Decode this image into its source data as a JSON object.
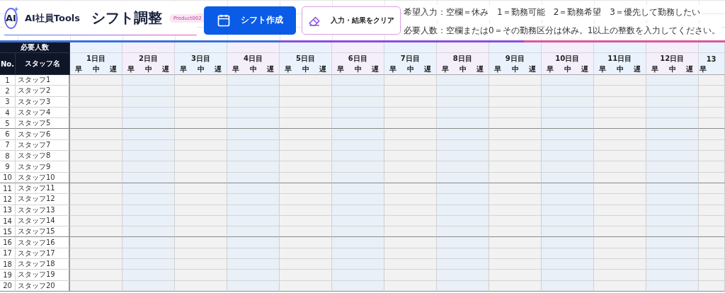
{
  "logo": {
    "mark": "AI",
    "name": "AI社員Tools"
  },
  "title": "シフト調整",
  "badge": "Product002",
  "buttons": [
    {
      "kind": "primary",
      "label": "シフト作成"
    },
    {
      "kind": "outline",
      "label": "入力・結果をクリア"
    }
  ],
  "notes": [
    "希望入力：空欄＝休み　1＝勤務可能　2＝勤務希望　3＝優先して勤務したい",
    "必要人数：空欄または0＝その勤務区分は休み。1以上の整数を入力してください。"
  ],
  "table": {
    "required_label": "必要人数",
    "no_header": "No.",
    "name_header": "スタッフ名",
    "days": [
      {
        "label": "1日目",
        "shifts": [
          "早",
          "中",
          "遅"
        ]
      },
      {
        "label": "2日目",
        "shifts": [
          "早",
          "中",
          "遅"
        ]
      },
      {
        "label": "3日目",
        "shifts": [
          "早",
          "中",
          "遅"
        ]
      },
      {
        "label": "4日目",
        "shifts": [
          "早",
          "中",
          "遅"
        ]
      },
      {
        "label": "5日目",
        "shifts": [
          "早",
          "中",
          "遅"
        ]
      },
      {
        "label": "6日目",
        "shifts": [
          "早",
          "中",
          "遅"
        ]
      },
      {
        "label": "7日目",
        "shifts": [
          "早",
          "中",
          "遅"
        ]
      },
      {
        "label": "8日目",
        "shifts": [
          "早",
          "中",
          "遅"
        ]
      },
      {
        "label": "9日目",
        "shifts": [
          "早",
          "中",
          "遅"
        ]
      },
      {
        "label": "10日目",
        "shifts": [
          "早",
          "中",
          "遅"
        ]
      },
      {
        "label": "11日目",
        "shifts": [
          "早",
          "中",
          "遅"
        ]
      },
      {
        "label": "12日目",
        "shifts": [
          "早",
          "中",
          "遅"
        ]
      },
      {
        "label": "13",
        "shifts": [
          "早"
        ]
      }
    ],
    "staff": [
      {
        "no": "1",
        "name": "スタッフ1"
      },
      {
        "no": "2",
        "name": "スタッフ2"
      },
      {
        "no": "3",
        "name": "スタッフ3"
      },
      {
        "no": "4",
        "name": "スタッフ4"
      },
      {
        "no": "5",
        "name": "スタッフ5"
      },
      {
        "no": "6",
        "name": "スタッフ6"
      },
      {
        "no": "7",
        "name": "スタッフ7"
      },
      {
        "no": "8",
        "name": "スタッフ8"
      },
      {
        "no": "9",
        "name": "スタッフ9"
      },
      {
        "no": "10",
        "name": "スタッフ10"
      },
      {
        "no": "11",
        "name": "スタッフ11"
      },
      {
        "no": "12",
        "name": "スタッフ12"
      },
      {
        "no": "13",
        "name": "スタッフ13"
      },
      {
        "no": "14",
        "name": "スタッフ14"
      },
      {
        "no": "15",
        "name": "スタッフ15"
      },
      {
        "no": "16",
        "name": "スタッフ16"
      },
      {
        "no": "17",
        "name": "スタッフ17"
      },
      {
        "no": "18",
        "name": "スタッフ18"
      },
      {
        "no": "19",
        "name": "スタッフ19"
      },
      {
        "no": "20",
        "name": "スタッフ20"
      }
    ]
  }
}
